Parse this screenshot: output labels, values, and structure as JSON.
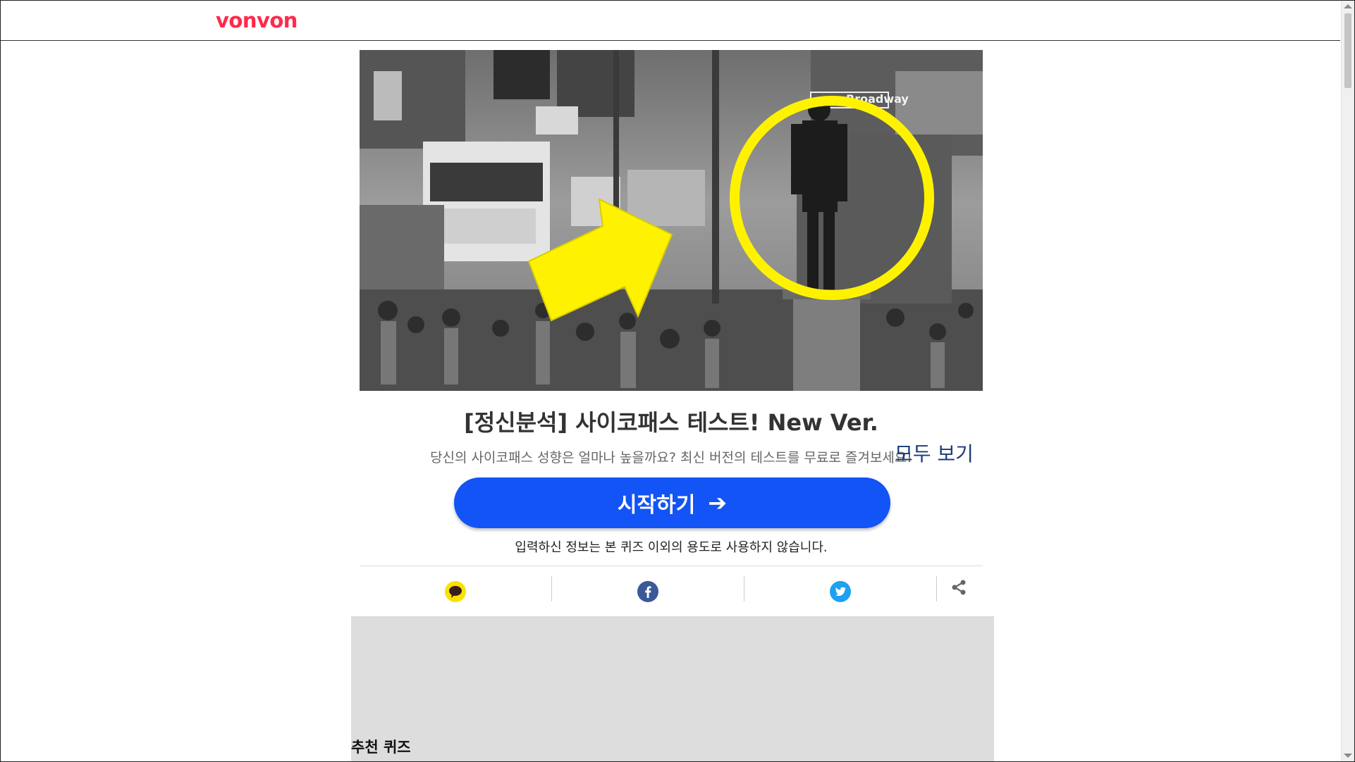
{
  "header": {
    "logo_text": "vonvon"
  },
  "quiz": {
    "title": "[정신분석] 사이코패스 테스트! New Ver.",
    "description": "당신의 사이코패스 성향은 얼마나 높을까요? 최신 버전의 테스트를 무료로 즐겨보세요!",
    "view_all": "모두 보기",
    "start_label": "시작하기",
    "privacy_note": "입력하신 정보는 본 퀴즈 이외의 용도로 사용하지 않습니다."
  },
  "hero": {
    "sign_text": "Broadway",
    "accent_color": "#fff200"
  },
  "share": {
    "items": [
      {
        "icon": "kakaotalk-icon",
        "color": "#fae100"
      },
      {
        "icon": "facebook-icon",
        "color": "#3b5998"
      },
      {
        "icon": "twitter-icon",
        "color": "#1da1f2"
      },
      {
        "icon": "share-icon",
        "color": "#666666"
      }
    ]
  },
  "recommend": {
    "heading": "추천 퀴즈"
  },
  "colors": {
    "brand": "#ff2a4b",
    "button": "#1254f5",
    "ad_background": "#dddddd"
  }
}
